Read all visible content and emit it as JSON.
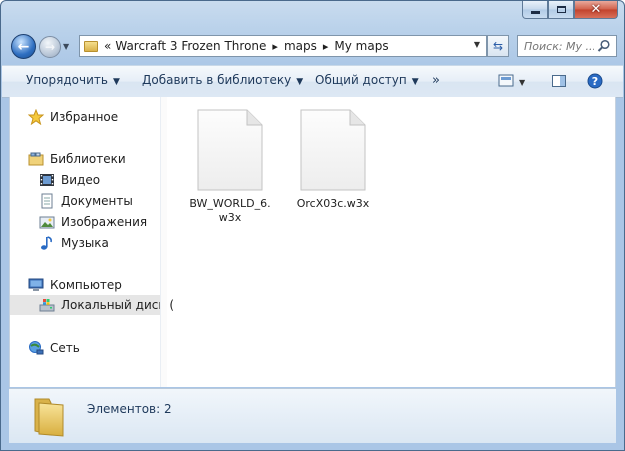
{
  "window": {
    "colors": {
      "frame": "#b9d1ea",
      "toolbar": "#e6eef7",
      "selection": "#e6e6e6",
      "close": "#c2422c"
    }
  },
  "navigation": {
    "breadcrumb_prefix": "«",
    "breadcrumbs": [
      "Warcraft 3 Frozen Throne",
      "maps",
      "My maps"
    ],
    "search_placeholder": "Поиск: My ..."
  },
  "toolbar": {
    "organize": "Упорядочить",
    "add_to_library": "Добавить в библиотеку",
    "share": "Общий доступ",
    "more": "»"
  },
  "sidebar": {
    "favorites": "Избранное",
    "libraries": "Библиотеки",
    "library_items": [
      "Видео",
      "Документы",
      "Изображения",
      "Музыка"
    ],
    "computer": "Компьютер",
    "local_disk": "Локальный диск (",
    "network": "Сеть"
  },
  "files": [
    {
      "name": "BW_WORLD_6.w3x",
      "icon": "blank-file-icon"
    },
    {
      "name": "OrcX03c.w3x",
      "icon": "blank-file-icon"
    }
  ],
  "details": {
    "item_count": "Элементов: 2"
  }
}
